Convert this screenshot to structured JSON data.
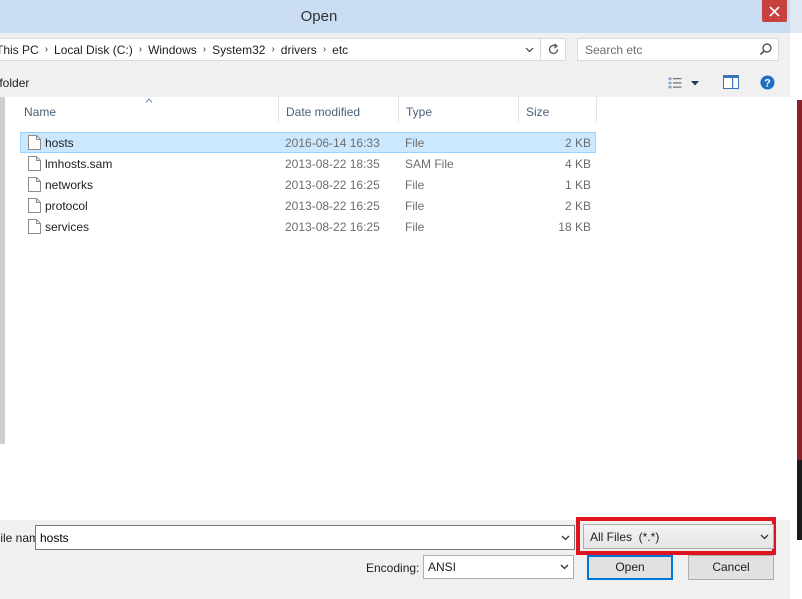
{
  "window": {
    "title": "Open",
    "close_label": "close"
  },
  "address": {
    "crumbs": [
      "This PC",
      "Local Disk (C:)",
      "Windows",
      "System32",
      "drivers",
      "etc"
    ]
  },
  "search": {
    "placeholder": "Search etc"
  },
  "toolbar": {
    "new_folder_label": "New folder"
  },
  "columns": {
    "name": "Name",
    "date": "Date modified",
    "type": "Type",
    "size": "Size"
  },
  "files": [
    {
      "name": "hosts",
      "date": "2016-06-14 16:33",
      "type": "File",
      "size": "2 KB",
      "selected": true
    },
    {
      "name": "lmhosts.sam",
      "date": "2013-08-22 18:35",
      "type": "SAM File",
      "size": "4 KB",
      "selected": false
    },
    {
      "name": "networks",
      "date": "2013-08-22 16:25",
      "type": "File",
      "size": "1 KB",
      "selected": false
    },
    {
      "name": "protocol",
      "date": "2013-08-22 16:25",
      "type": "File",
      "size": "2 KB",
      "selected": false
    },
    {
      "name": "services",
      "date": "2013-08-22 16:25",
      "type": "File",
      "size": "18 KB",
      "selected": false
    }
  ],
  "bottom": {
    "filename_label": "File name:",
    "filename_value": "hosts",
    "filter_value": "All Files  (*.*)",
    "encoding_label": "Encoding:",
    "encoding_value": "ANSI",
    "open_label": "Open",
    "cancel_label": "Cancel"
  },
  "colors": {
    "highlight": "#e0141e",
    "selection": "#cce8ff",
    "close": "#c7413e"
  }
}
